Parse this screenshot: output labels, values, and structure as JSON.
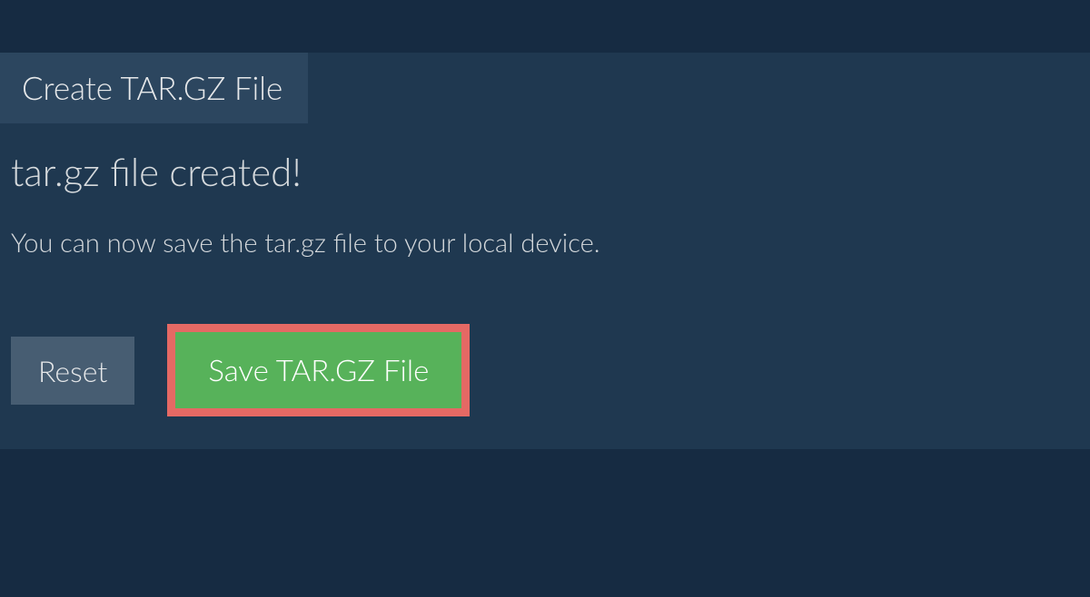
{
  "tab": {
    "label": "Create TAR.GZ File"
  },
  "status": {
    "heading": "tar.gz file created!",
    "description": "You can now save the tar.gz file to your local device."
  },
  "buttons": {
    "reset_label": "Reset",
    "save_label": "Save TAR.GZ File"
  }
}
